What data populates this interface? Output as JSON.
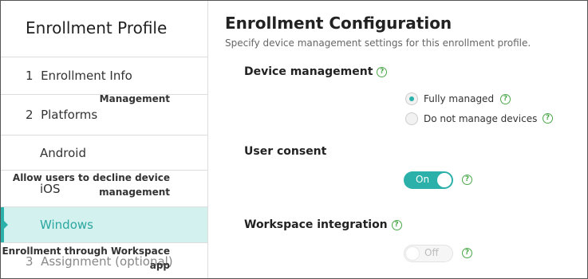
{
  "sidebar": {
    "title": "Enrollment Profile",
    "items": [
      {
        "label": "1  Enrollment Info"
      },
      {
        "label": "2  Platforms"
      },
      {
        "label": "Android"
      },
      {
        "label": "iOS"
      },
      {
        "label": "Windows"
      },
      {
        "label": "3  Assignment (optional)"
      }
    ]
  },
  "main": {
    "title": "Enrollment Configuration",
    "subtitle": "Specify device management settings for this enrollment profile.",
    "device_management": {
      "heading": "Device management",
      "management_label": "Management",
      "options": [
        "Fully managed",
        "Do not manage devices"
      ],
      "selected": "Fully managed"
    },
    "user_consent": {
      "heading": "User consent",
      "label_line1": "Allow users to decline device",
      "label_line2": "management",
      "toggle": "On"
    },
    "workspace_integration": {
      "heading": "Workspace integration",
      "label_line1": "Enrollment through Workspace",
      "label_line2": "app",
      "toggle": "Off"
    }
  },
  "help_glyph": "?",
  "colors": {
    "accent": "#2bb0aa",
    "active_bg": "#d3f1ee",
    "help_green": "#4aa84a"
  }
}
